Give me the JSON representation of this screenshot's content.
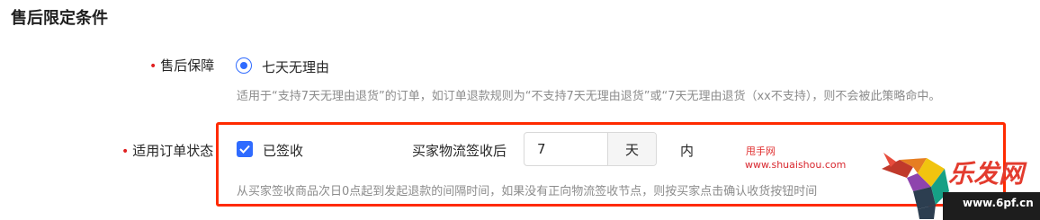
{
  "section_title": "售后限定条件",
  "after_sales": {
    "label": "售后保障",
    "option": "七天无理由",
    "help": "适用于“支持7天无理由退货”的订单，如订单退款规则为“不支持7天无理由退货”或“7天无理由退货（xx不支持），则不会被此策略命中。"
  },
  "order_status": {
    "label": "适用订单状态",
    "checkbox_label": "已签收",
    "field_label": "买家物流签收后",
    "value": "7",
    "unit": "天",
    "suffix": "内",
    "help": "从买家签收商品次日0点起到发起退款的间隔时间，如果没有正向物流签收节点，则按买家点击确认收货按钮时间"
  },
  "watermarks": {
    "cn": "甩手网",
    "url": "www.shuaishou.com",
    "logo_text": "乐发网",
    "logo_site": "www.6pf.cn"
  },
  "colors": {
    "primary": "#2f6bff",
    "highlight": "#ff2a00",
    "required": "#e02020"
  }
}
